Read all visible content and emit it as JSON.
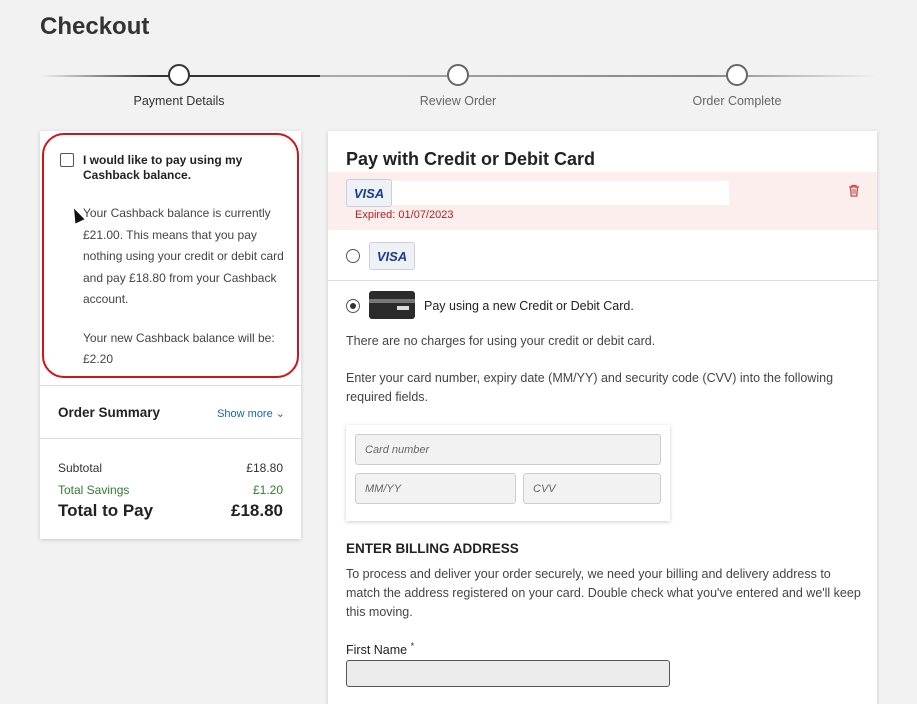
{
  "page": {
    "title": "Checkout"
  },
  "stepper": {
    "steps": [
      {
        "label": "Payment Details"
      },
      {
        "label": "Review Order"
      },
      {
        "label": "Order Complete"
      }
    ]
  },
  "cashback": {
    "title": "I would like to pay using my Cashback balance.",
    "description": "Your Cashback balance is currently £21.00. This means that you pay nothing using your credit or debit card and pay £18.80 from your Cashback account.",
    "new_balance": "Your new Cashback balance will be: £2.20"
  },
  "order_summary": {
    "title": "Order Summary",
    "show_more": "Show more",
    "subtotal_label": "Subtotal",
    "subtotal_value": "£18.80",
    "savings_label": "Total Savings",
    "savings_value": "£1.20",
    "total_label": "Total to Pay",
    "total_value": "£18.80"
  },
  "payment": {
    "title": "Pay with Credit or Debit Card",
    "saved_cards": [
      {
        "brand": "VISA",
        "expired_text": "Expired: 01/07/2023"
      },
      {
        "brand": "VISA"
      }
    ],
    "new_card_label": "Pay using a new Credit or Debit Card.",
    "no_charges": "There are no charges for using your credit or debit card.",
    "instructions": "Enter your card number, expiry date (MM/YY) and security code (CVV) into the following required fields.",
    "card_number_placeholder": "Card number",
    "expiry_placeholder": "MM/YY",
    "cvv_placeholder": "CVV"
  },
  "billing": {
    "title": "ENTER BILLING ADDRESS",
    "description": "To process and deliver your order securely, we need your billing and delivery address to match the address registered on your card. Double check what you've entered and we'll keep this moving.",
    "first_name_label": "First Name",
    "required_mark": "*"
  },
  "colors": {
    "highlight_border": "#d0141b",
    "link": "#1a66a8",
    "savings": "#2e7d32",
    "expired_bg": "#fdeeee",
    "expired_text": "#b02020"
  }
}
